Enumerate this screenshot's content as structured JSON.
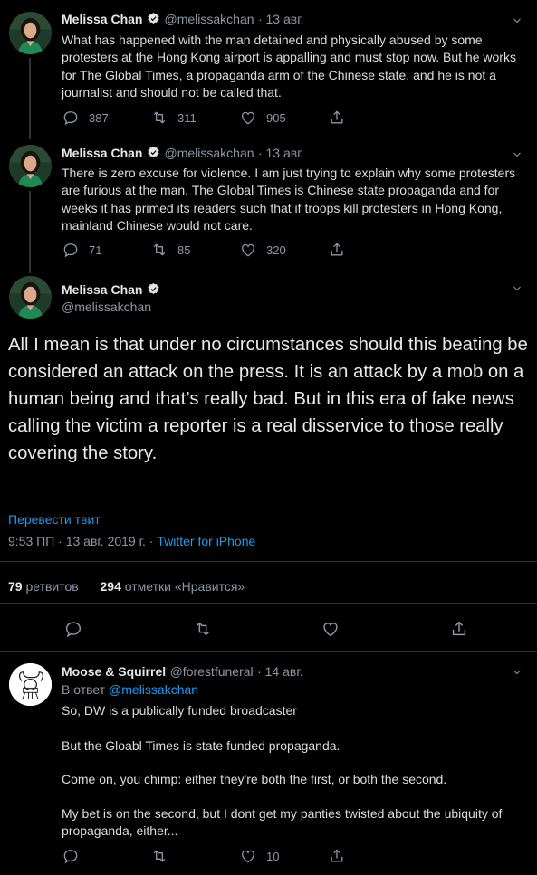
{
  "tweets": [
    {
      "name": "Melissa Chan",
      "handle": "@melissakchan",
      "date": "· 13 авг.",
      "text": "What has happened with the man detained and physically abused by some protesters at the Hong Kong airport is appalling and must stop now. But he works for The Global Times, a propaganda arm of the Chinese state, and he is not a journalist and should not be called that.",
      "replies": "387",
      "retweets": "311",
      "likes": "905"
    },
    {
      "name": "Melissa Chan",
      "handle": "@melissakchan",
      "date": "· 13 авг.",
      "text": "There is zero excuse for violence. I am just trying to explain why some protesters are furious at the man. The Global Times is Chinese state propaganda and for weeks it has primed its readers such that if troops kill protesters in Hong Kong, mainland Chinese would not care.",
      "replies": "71",
      "retweets": "85",
      "likes": "320"
    }
  ],
  "main": {
    "name": "Melissa Chan",
    "handle": "@melissakchan",
    "text": "All I mean is that under no circumstances should this beating be considered an attack on the press. It is an attack by a mob on a human being and that’s really bad. But in this era of fake news calling the victim a reporter is a real disservice to those really covering the story.",
    "translate": "Перевести твит",
    "time": "9:53 ПП · 13 авг. 2019 г. ·",
    "source": "Twitter for iPhone",
    "retweet_count": "79",
    "retweet_label": "ретвитов",
    "like_count": "294",
    "like_label": "отметки «Нравится»"
  },
  "reply": {
    "name": "Moose & Squirrel",
    "handle": "@forestfuneral",
    "date": "· 14 авг.",
    "reply_prefix": "В ответ",
    "reply_to": "@melissakchan",
    "p1": "So, DW is a publically funded broadcaster",
    "p2": "But the Gloabl Times is state funded propaganda.",
    "p3": "Come on, you chimp: either they're both the first, or both the second.",
    "p4": "My bet is on the second, but I dont get my panties twisted about the ubiquity of propaganda, either...",
    "likes": "10"
  },
  "colors": {
    "accent": "#1d9bf0",
    "muted": "#8b98a5",
    "divider": "#2f3336",
    "background": "#000000"
  }
}
